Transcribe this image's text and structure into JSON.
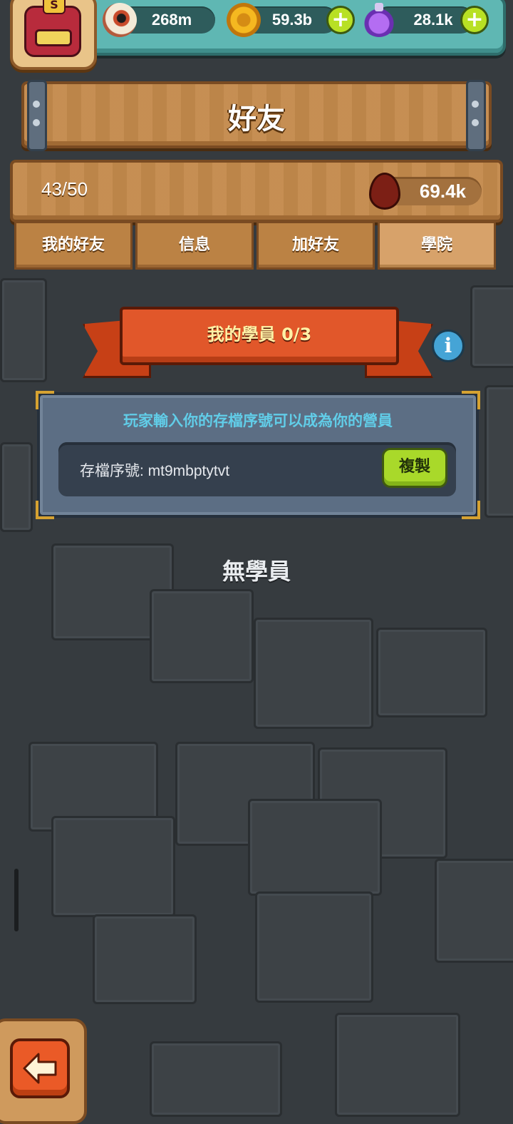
{
  "resources": {
    "eyes": "268m",
    "coins": "59.3b",
    "potions": "28.1k"
  },
  "avatar": {
    "badge": "S"
  },
  "title": "好友",
  "stats": {
    "friend_count": "43/50",
    "blood": "69.4k"
  },
  "tabs": [
    {
      "label": "我的好友",
      "active": false
    },
    {
      "label": "信息",
      "active": false
    },
    {
      "label": "加好友",
      "active": false
    },
    {
      "label": "學院",
      "active": true
    }
  ],
  "ribbon": {
    "title": "我的學員 0/3"
  },
  "panel": {
    "hint": "玩家輸入你的存檔序號可以成為你的營員",
    "save_code": "存檔序號: mt9mbptytvt",
    "copy_label": "複製"
  },
  "empty_message": "無學員",
  "icons": {
    "eye": "eyeball-icon",
    "coin": "coin-icon",
    "potion": "potion-icon",
    "plus": "plus-icon",
    "drop": "blood-drop-icon",
    "info": "info-icon",
    "back": "back-arrow-icon"
  },
  "colors": {
    "background": "#363b3f",
    "wood": "#c48a4c",
    "ribbon": "#e1572a",
    "copy_button": "#a9d92a",
    "hint_text": "#61cde8",
    "teal_bar": "#5fb7b3"
  }
}
